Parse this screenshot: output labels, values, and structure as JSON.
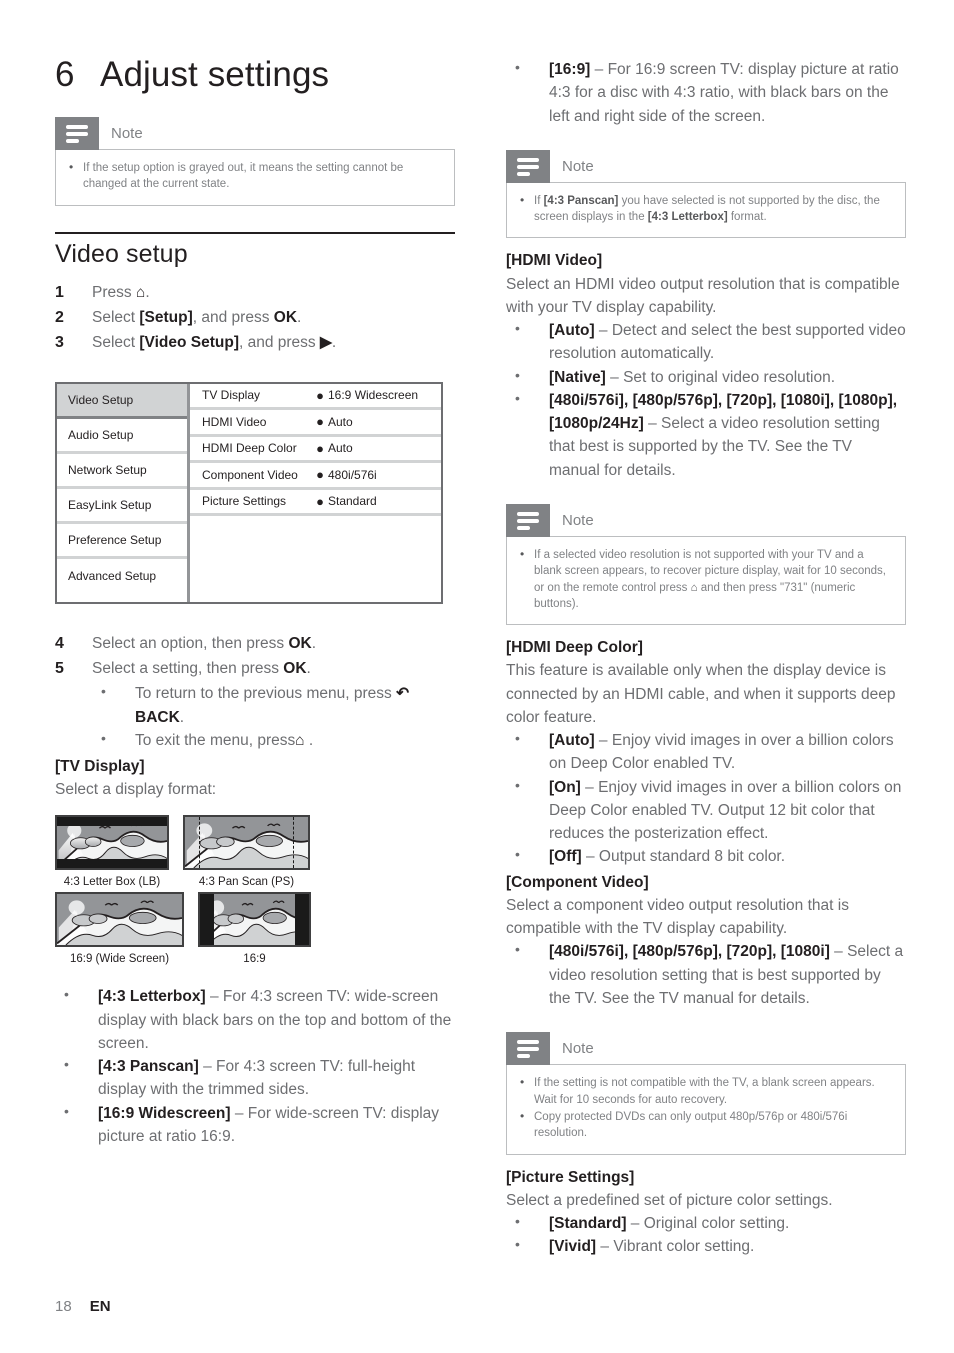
{
  "chapter": {
    "number": "6",
    "title": "Adjust settings"
  },
  "notes": {
    "label": "Note",
    "note1": {
      "line": "If the setup option is grayed out, it means the setting cannot be changed at the current state."
    },
    "note2": {
      "pre": "If ",
      "b1": "[4:3 Panscan]",
      "mid": " you have selected is not supported by the disc, the screen displays in the ",
      "b2": "[4:3 Letterbox]",
      "post": " format."
    },
    "note3": {
      "pre": "If a selected video resolution is not supported with your TV and a blank screen appears, to recover picture display, wait for 10 seconds, or on the remote control press ",
      "icon": "home-icon",
      "post": " and then press \"731\" (numeric buttons)."
    },
    "note4": {
      "line1": "If the setting is not compatible with the TV, a blank screen appears. Wait for 10 seconds for auto recovery.",
      "line2": "Copy protected DVDs can only output 480p/576p or 480i/576i resolution."
    }
  },
  "video_setup": {
    "heading": "Video setup",
    "steps": [
      {
        "num": "1",
        "pre": "Press ",
        "icon": "⌂",
        "post": "."
      },
      {
        "num": "2",
        "pre": "Select ",
        "bold": "[Setup]",
        "mid": ", and press ",
        "bold2": "OK",
        "post": "."
      },
      {
        "num": "3",
        "pre": "Select ",
        "bold": "[Video Setup]",
        "mid": ", and press ",
        "icon": "▶",
        "post": "."
      },
      {
        "num": "4",
        "pre": "Select an option, then press ",
        "bold2": "OK",
        "post": "."
      },
      {
        "num": "5",
        "pre": "Select a setting, then press ",
        "bold2": "OK",
        "post": "."
      }
    ],
    "sub_bullets": [
      {
        "pre": "To return to the previous menu, press ",
        "icon": "↶",
        "bold": "BACK",
        "post": "."
      },
      {
        "pre": "To exit the menu, press",
        "icon": "⌂",
        "post": " ."
      }
    ]
  },
  "setup_menu": {
    "left_items": [
      {
        "label": "Video Setup",
        "selected": true
      },
      {
        "label": "Audio Setup",
        "selected": false
      },
      {
        "label": "Network Setup",
        "selected": false
      },
      {
        "label": "EasyLink Setup",
        "selected": false
      },
      {
        "label": "Preference Setup",
        "selected": false
      },
      {
        "label": "Advanced Setup",
        "selected": false
      }
    ],
    "rows": [
      {
        "label": "TV Display",
        "dot": "●",
        "value": "16:9 Widescreen"
      },
      {
        "label": "HDMI Video",
        "dot": "●",
        "value": "Auto"
      },
      {
        "label": "HDMI Deep Color",
        "dot": "●",
        "value": "Auto"
      },
      {
        "label": "Component Video",
        "dot": "●",
        "value": "480i/576i"
      },
      {
        "label": "Picture Settings",
        "dot": "●",
        "value": "Standard"
      }
    ]
  },
  "tv_display": {
    "heading": "[TV Display]",
    "intro": "Select a display format:",
    "figures": [
      {
        "caption": "4:3 Letter Box (LB)"
      },
      {
        "caption": "4:3 Pan Scan (PS)"
      },
      {
        "caption": "16:9 (Wide Screen)"
      },
      {
        "caption": "16:9"
      }
    ],
    "bullets": [
      {
        "bold": "[4:3 Letterbox]",
        "text": " – For 4:3 screen TV: wide-screen display with black bars on the top and bottom of the screen."
      },
      {
        "bold": "[4:3 Panscan]",
        "text": " – For 4:3 screen TV: full-height display with the trimmed sides."
      },
      {
        "bold": "[16:9 Widescreen]",
        "text": " – For wide-screen TV: display picture at ratio 16:9."
      },
      {
        "bold": "[16:9]",
        "text": " – For 16:9 screen TV: display picture at ratio 4:3 for a disc with 4:3 ratio, with black bars on the left and right side of the screen."
      }
    ]
  },
  "hdmi_video": {
    "heading": "[HDMI Video]",
    "intro": "Select an HDMI video output resolution that is compatible with your TV display capability.",
    "bullets": [
      {
        "bold": "[Auto]",
        "text": " – Detect and select the best supported video resolution automatically."
      },
      {
        "bold": "[Native]",
        "text": " – Set to original video resolution."
      },
      {
        "bold": "[480i/576i], [480p/576p], [720p], [1080i], [1080p], [1080p/24Hz]",
        "text": " – Select a video resolution setting that best is supported by the TV. See the TV manual for details."
      }
    ]
  },
  "hdmi_deep_color": {
    "heading": "[HDMI Deep Color]",
    "intro": "This feature is available only when the display device is connected by an HDMI cable, and when it supports deep color feature.",
    "bullets": [
      {
        "bold": "[Auto]",
        "text": " – Enjoy vivid images in over a billion colors on Deep Color enabled TV."
      },
      {
        "bold": "[On]",
        "text": " – Enjoy vivid images in over a billion colors on Deep Color enabled TV. Output 12 bit color that reduces the posterization effect."
      },
      {
        "bold": "[Off]",
        "text": " – Output standard 8 bit color."
      }
    ]
  },
  "component_video": {
    "heading": "[Component Video]",
    "intro": "Select a component video output resolution that is compatible with the TV display capability.",
    "bullets": [
      {
        "bold": "[480i/576i], [480p/576p], [720p], [1080i]",
        "text": " – Select a video resolution setting that is best supported by the TV. See the TV manual for details."
      }
    ]
  },
  "picture_settings": {
    "heading": "[Picture Settings]",
    "intro": "Select a predefined set of picture color settings.",
    "bullets": [
      {
        "bold": "[Standard]",
        "text": " – Original color setting."
      },
      {
        "bold": "[Vivid]",
        "text": " – Vibrant color setting."
      }
    ]
  },
  "footer": {
    "page": "18",
    "language": "EN"
  },
  "colors": {
    "body_text": "#6d6e71",
    "emphasis": "#231f20",
    "note_gray": "#808285",
    "menu_selected": "#d1d3d4",
    "figure_sky": "#939598"
  }
}
